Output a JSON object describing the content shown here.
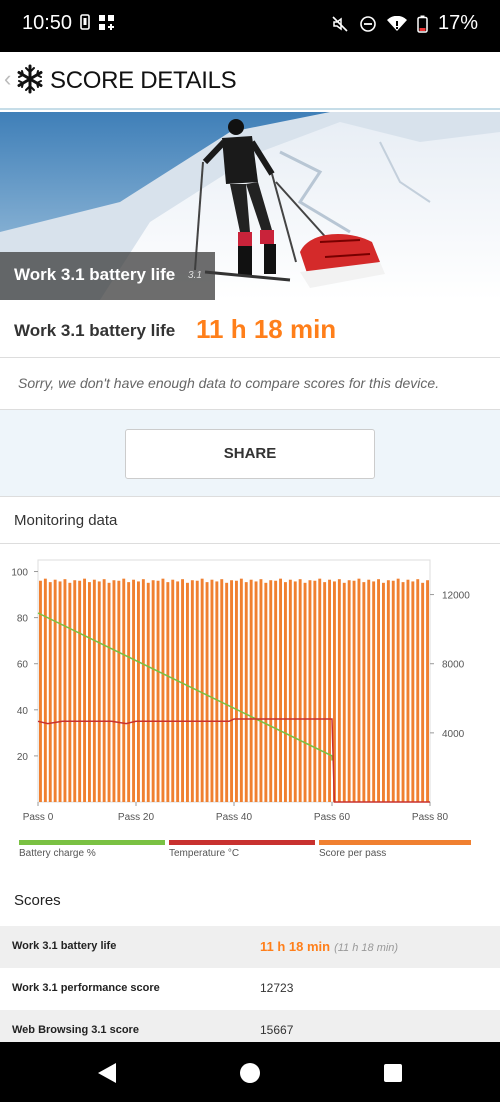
{
  "status_bar": {
    "time": "10:50",
    "battery_percent": "17%",
    "icons": [
      "sim-icon",
      "app-grid-icon",
      "mute-icon",
      "dnd-icon",
      "wifi-icon",
      "battery-icon"
    ]
  },
  "app_bar": {
    "title": "SCORE DETAILS",
    "back_icon": "chevron-left-icon",
    "logo_icon": "snowflake-icon"
  },
  "hero": {
    "caption": "Work 3.1 battery life",
    "version": "3.1"
  },
  "result": {
    "label": "Work 3.1 battery life",
    "value": "11 h 18 min"
  },
  "note": "Sorry, we don't have enough data to compare scores for this device.",
  "share_label": "SHARE",
  "monitoring": {
    "title": "Monitoring data"
  },
  "chart_data": {
    "type": "bar",
    "left_axis": {
      "ticks": [
        "100",
        "80",
        "60",
        "40",
        "20"
      ],
      "range": [
        0,
        105
      ]
    },
    "right_axis": {
      "ticks": [
        "12000",
        "8000",
        "4000"
      ],
      "range": [
        0,
        14000
      ]
    },
    "x_ticks": [
      "Pass 0",
      "Pass 20",
      "Pass 40",
      "Pass 60",
      "Pass 80"
    ],
    "x_range": [
      0,
      80
    ],
    "series": [
      {
        "name": "Battery charge %",
        "color": "#7ac143",
        "axis": "left",
        "type": "line",
        "x": [
          0,
          60,
          60
        ],
        "values": [
          82,
          20,
          18
        ]
      },
      {
        "name": "Temperature °C",
        "color": "#c8312f",
        "axis": "left",
        "type": "line",
        "x": [
          0,
          2,
          5,
          10,
          15,
          18,
          20,
          25,
          30,
          39,
          40,
          50,
          60,
          60.5,
          80
        ],
        "values": [
          35,
          34,
          35,
          35,
          35,
          34,
          35,
          35,
          35,
          35,
          36,
          36,
          36,
          0,
          0
        ]
      },
      {
        "name": "Score per pass",
        "color": "#f08030",
        "axis": "right",
        "type": "bar",
        "passes": 80,
        "value_approx": 12800
      }
    ],
    "legend_position": "bottom"
  },
  "legend": {
    "battery": "Battery charge %",
    "temperature": "Temperature °C",
    "score": "Score per pass",
    "battery_color": "#7ac143",
    "temperature_color": "#c8312f",
    "score_color": "#f08030"
  },
  "scores": {
    "title": "Scores",
    "rows": [
      {
        "label": "Work 3.1 battery life",
        "value": "11 h 18 min",
        "sub": "(11 h 18 min)"
      },
      {
        "label": "Work 3.1 performance score",
        "value": "12723"
      },
      {
        "label": "Web Browsing 3.1 score",
        "value": "15667"
      }
    ]
  },
  "nav_bar": {
    "icons": [
      "back-triangle-icon",
      "home-circle-icon",
      "recents-square-icon"
    ]
  }
}
